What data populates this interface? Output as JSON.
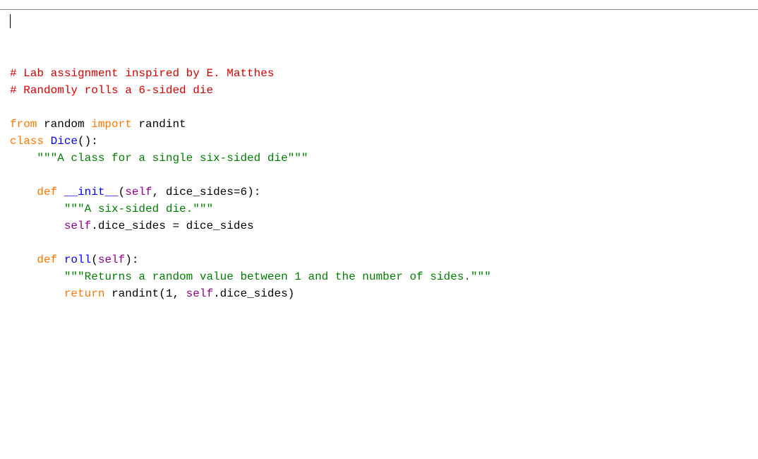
{
  "code": {
    "lines": [
      [
        {
          "cls": "tok-comment",
          "text": "# Lab assignment inspired by E. Matthes"
        }
      ],
      [
        {
          "cls": "tok-comment",
          "text": "# Randomly rolls a 6-sided die"
        }
      ],
      [
        {
          "cls": "tok-name",
          "text": ""
        }
      ],
      [
        {
          "cls": "tok-keyword",
          "text": "from"
        },
        {
          "cls": "tok-name",
          "text": " random "
        },
        {
          "cls": "tok-keyword",
          "text": "import"
        },
        {
          "cls": "tok-name",
          "text": " randint"
        }
      ],
      [
        {
          "cls": "tok-keyword",
          "text": "class"
        },
        {
          "cls": "tok-name",
          "text": " "
        },
        {
          "cls": "tok-classname",
          "text": "Dice"
        },
        {
          "cls": "tok-punct",
          "text": "():"
        }
      ],
      [
        {
          "cls": "tok-name",
          "text": "    "
        },
        {
          "cls": "tok-string",
          "text": "\"\"\"A class for a single six-sided die\"\"\""
        }
      ],
      [
        {
          "cls": "tok-name",
          "text": ""
        }
      ],
      [
        {
          "cls": "tok-name",
          "text": "    "
        },
        {
          "cls": "tok-keyword",
          "text": "def"
        },
        {
          "cls": "tok-name",
          "text": " "
        },
        {
          "cls": "tok-classname",
          "text": "__init__"
        },
        {
          "cls": "tok-punct",
          "text": "("
        },
        {
          "cls": "tok-builtin",
          "text": "self"
        },
        {
          "cls": "tok-punct",
          "text": ", dice_sides="
        },
        {
          "cls": "tok-number",
          "text": "6"
        },
        {
          "cls": "tok-punct",
          "text": "):"
        }
      ],
      [
        {
          "cls": "tok-name",
          "text": "        "
        },
        {
          "cls": "tok-string",
          "text": "\"\"\"A six-sided die.\"\"\""
        }
      ],
      [
        {
          "cls": "tok-name",
          "text": "        "
        },
        {
          "cls": "tok-builtin",
          "text": "self"
        },
        {
          "cls": "tok-punct",
          "text": ".dice_sides = dice_sides"
        }
      ],
      [
        {
          "cls": "tok-name",
          "text": ""
        }
      ],
      [
        {
          "cls": "tok-name",
          "text": "    "
        },
        {
          "cls": "tok-keyword",
          "text": "def"
        },
        {
          "cls": "tok-name",
          "text": " "
        },
        {
          "cls": "tok-classname",
          "text": "roll"
        },
        {
          "cls": "tok-punct",
          "text": "("
        },
        {
          "cls": "tok-builtin",
          "text": "self"
        },
        {
          "cls": "tok-punct",
          "text": "):"
        }
      ],
      [
        {
          "cls": "tok-name",
          "text": "        "
        },
        {
          "cls": "tok-string",
          "text": "\"\"\"Returns a random value between 1 and the number of sides.\"\"\""
        }
      ],
      [
        {
          "cls": "tok-name",
          "text": "        "
        },
        {
          "cls": "tok-keyword",
          "text": "return"
        },
        {
          "cls": "tok-name",
          "text": " randint("
        },
        {
          "cls": "tok-number",
          "text": "1"
        },
        {
          "cls": "tok-punct",
          "text": ", "
        },
        {
          "cls": "tok-builtin",
          "text": "self"
        },
        {
          "cls": "tok-punct",
          "text": ".dice_sides)"
        }
      ]
    ]
  }
}
